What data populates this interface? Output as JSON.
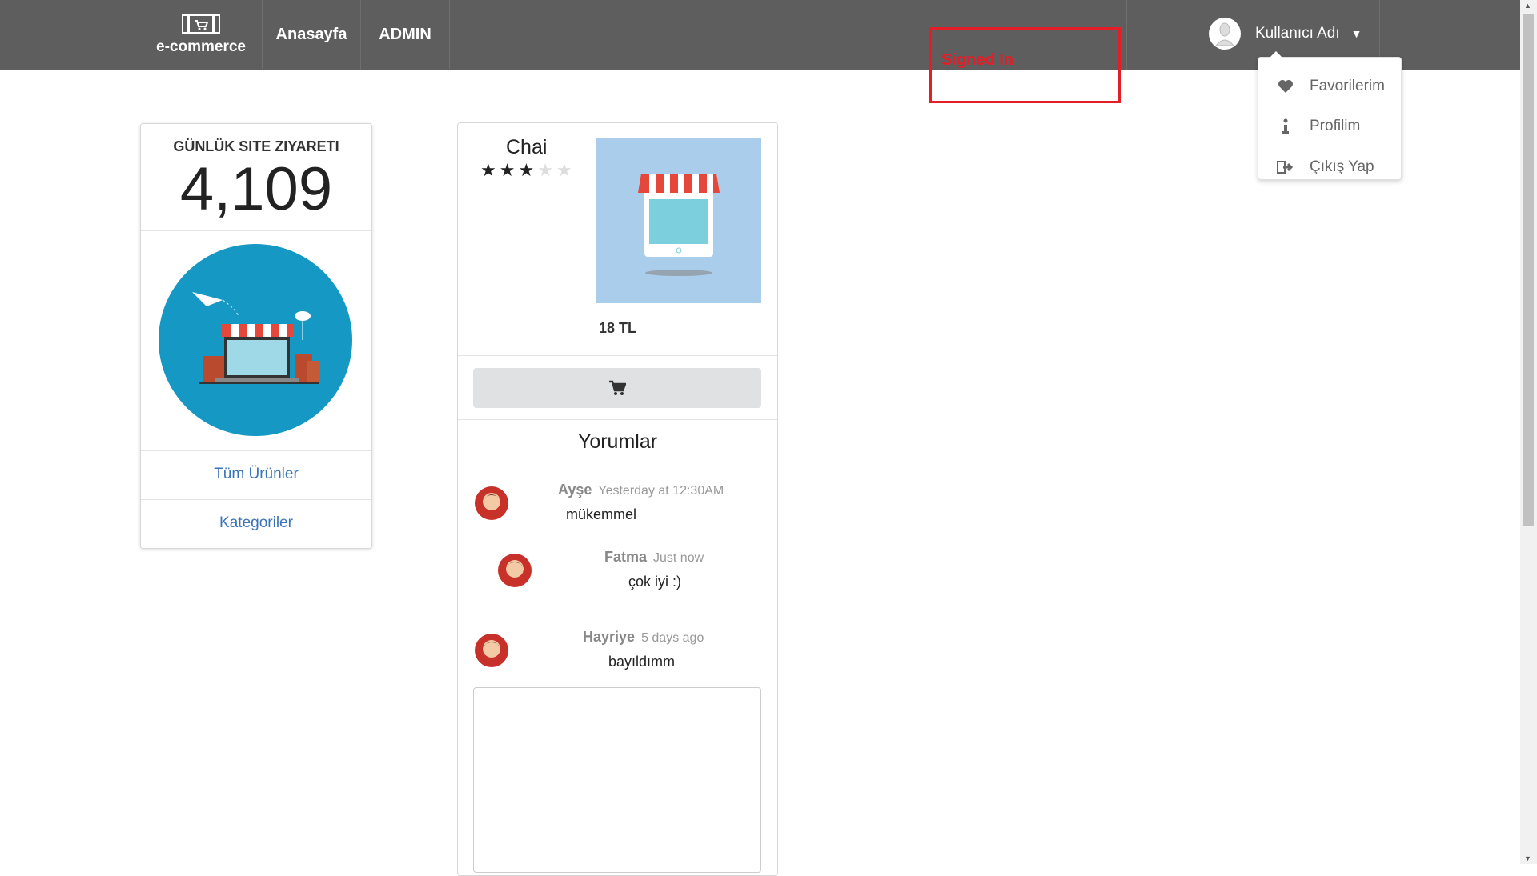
{
  "navbar": {
    "brand_text": "e-commerce",
    "home_label": "Anasayfa",
    "admin_label": "ADMIN",
    "user_name": "Kullanıcı Adı"
  },
  "annotation": {
    "signed_text": "Signed In",
    "color": "#e41e26"
  },
  "dropdown": {
    "items": [
      {
        "label": "Favorilerim",
        "icon": "heart-icon"
      },
      {
        "label": "Profilim",
        "icon": "info-icon"
      },
      {
        "label": "Çıkış Yap",
        "icon": "sign-out-icon"
      }
    ]
  },
  "left_card": {
    "title": "GÜNLÜK SITE ZIYARETI",
    "count": "4,109",
    "links": [
      "Tüm Ürünler",
      "Kategoriler"
    ]
  },
  "product": {
    "name": "Chai",
    "rating": 3,
    "max_rating": 5,
    "price": "18 TL",
    "reviews_title": "Yorumlar",
    "comments": [
      {
        "author": "Ayşe",
        "time": "Yesterday at 12:30AM",
        "text": "mükemmel"
      },
      {
        "author": "Fatma",
        "time": "Just now",
        "text": "çok iyi :)"
      },
      {
        "author": "Hayriye",
        "time": "5 days ago",
        "text": "bayıldımm"
      }
    ]
  },
  "colors": {
    "navbar": "#5e5e5e",
    "link": "#3a74b8",
    "circle": "#1598c4",
    "product_bg": "#a9cdeb"
  }
}
